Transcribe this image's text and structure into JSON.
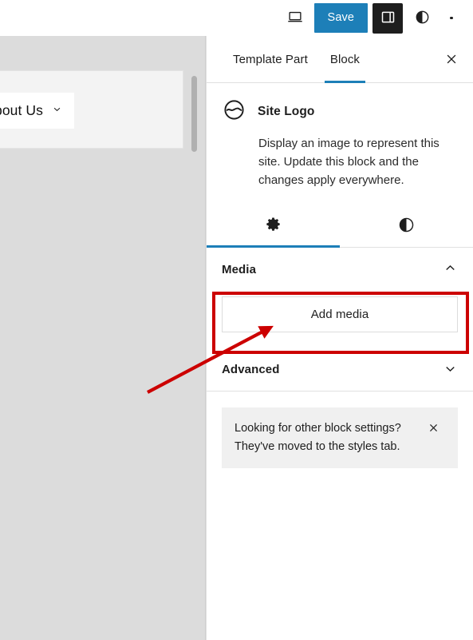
{
  "toolbar": {
    "view_icon": "laptop-icon",
    "save_label": "Save",
    "sidebar_toggle_icon": "sidebar-panel-icon",
    "styles_icon": "half-circle-contrast-icon",
    "options_icon": "three-dots-vertical-icon",
    "accent_color": "#1d7fb8",
    "toggle_bg": "#1e1e1e"
  },
  "canvas": {
    "nav_item_label": "bout Us",
    "nav_item_chevron": "chevron-down-icon",
    "background": "#dcdcdc",
    "frame_background": "#f3f3f3"
  },
  "sidebar": {
    "tabs": [
      {
        "label": "Template Part",
        "active": false
      },
      {
        "label": "Block",
        "active": true
      }
    ],
    "close_icon": "close-x-icon",
    "block": {
      "icon": "site-logo-icon",
      "title": "Site Logo",
      "description": "Display an image to represent this site. Update this block and the changes apply everywhere."
    },
    "subtabs": [
      {
        "icon": "gear-icon",
        "name": "settings",
        "active": true
      },
      {
        "icon": "half-circle-contrast-icon",
        "name": "styles",
        "active": false
      }
    ],
    "panels": [
      {
        "title": "Media",
        "expanded": true,
        "chevron": "chevron-up-icon",
        "button_label": "Add media"
      },
      {
        "title": "Advanced",
        "expanded": false,
        "chevron": "chevron-down-icon"
      }
    ],
    "notice": {
      "line1": "Looking for other block settings?",
      "line2": "They've moved to the styles tab.",
      "close_icon": "close-x-icon",
      "background": "#f0f0f0"
    }
  },
  "annotation": {
    "color": "#cc0000",
    "shapes": [
      "highlight-rectangle",
      "pointer-arrow"
    ],
    "target": "Add media"
  }
}
